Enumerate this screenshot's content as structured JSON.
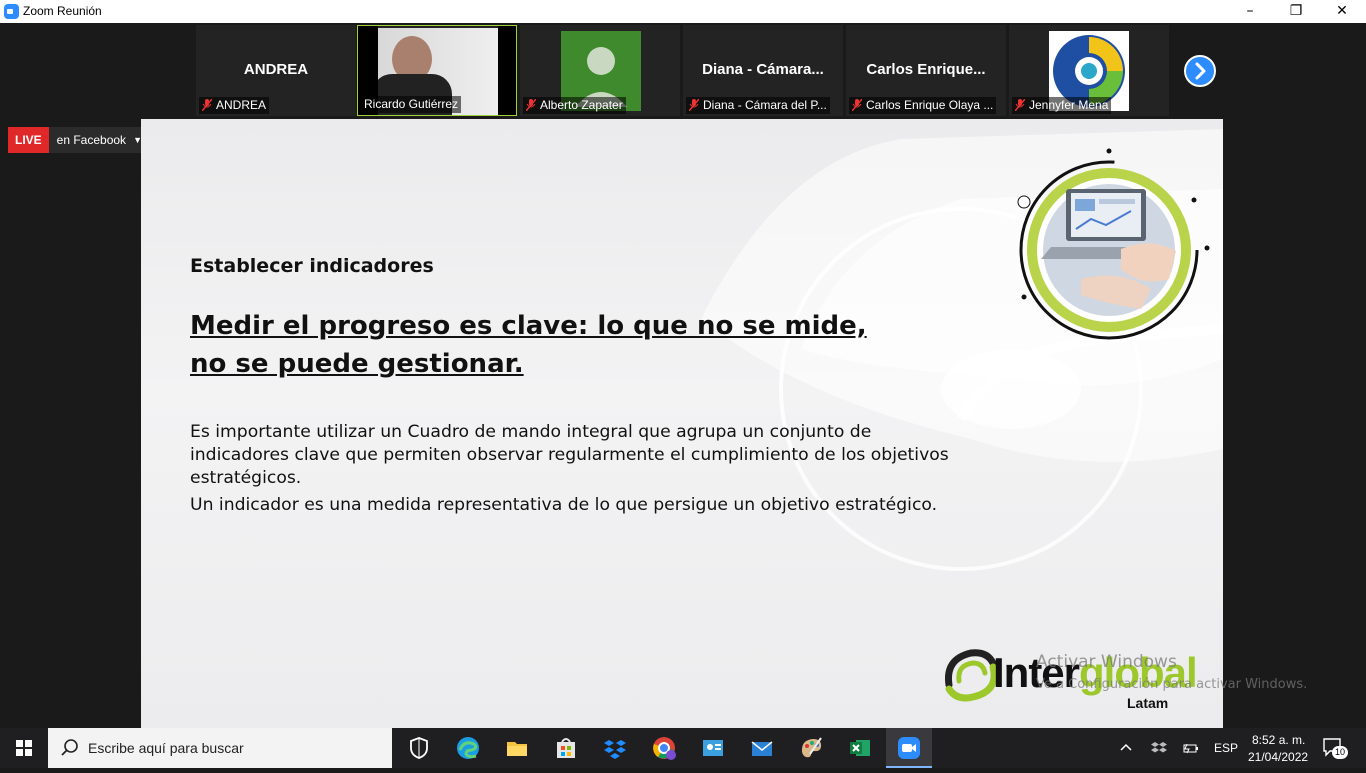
{
  "window": {
    "title": "Zoom Reunión",
    "controls": {
      "minimize": "–",
      "restore": "❐",
      "close": "✕"
    }
  },
  "participants": [
    {
      "big_name": "ANDREA",
      "label": "ANDREA",
      "muted": true,
      "type": "name"
    },
    {
      "big_name": "",
      "label": "Ricardo Gutiérrez",
      "muted": false,
      "type": "video"
    },
    {
      "big_name": "",
      "label": "Alberto Zapater",
      "muted": true,
      "type": "avatar"
    },
    {
      "big_name": "Diana  - Cámara...",
      "label": "Diana - Cámara del P...",
      "muted": true,
      "type": "name"
    },
    {
      "big_name": "Carlos  Enrique...",
      "label": "Carlos Enrique Olaya ...",
      "muted": true,
      "type": "name"
    },
    {
      "big_name": "",
      "label": "Jennyfer Mena",
      "muted": true,
      "type": "logo"
    }
  ],
  "live": {
    "badge": "LIVE",
    "destination": "en Facebook"
  },
  "slide": {
    "subtitle": "Establecer indicadores",
    "headline": "Medir el progreso es clave: lo que no se mide, no se puede gestionar.",
    "paragraph1": "Es importante utilizar un Cuadro de mando integral que agrupa un conjunto de indicadores clave que permiten observar regularmente el cumplimiento de los objetivos estratégicos.",
    "paragraph2": "Un indicador es una medida representativa de lo que persigue un objetivo estratégico.",
    "logo": {
      "inter": "Inter",
      "global": "global",
      "latam": "Latam"
    }
  },
  "watermark": {
    "line1": "Activar Windows",
    "line2": "Ve a Configuración para activar Windows."
  },
  "taskbar": {
    "search_placeholder": "Escribe aquí para buscar",
    "language": "ESP",
    "time": "8:52 a. m.",
    "date": "21/04/2022",
    "notifications": "10"
  }
}
